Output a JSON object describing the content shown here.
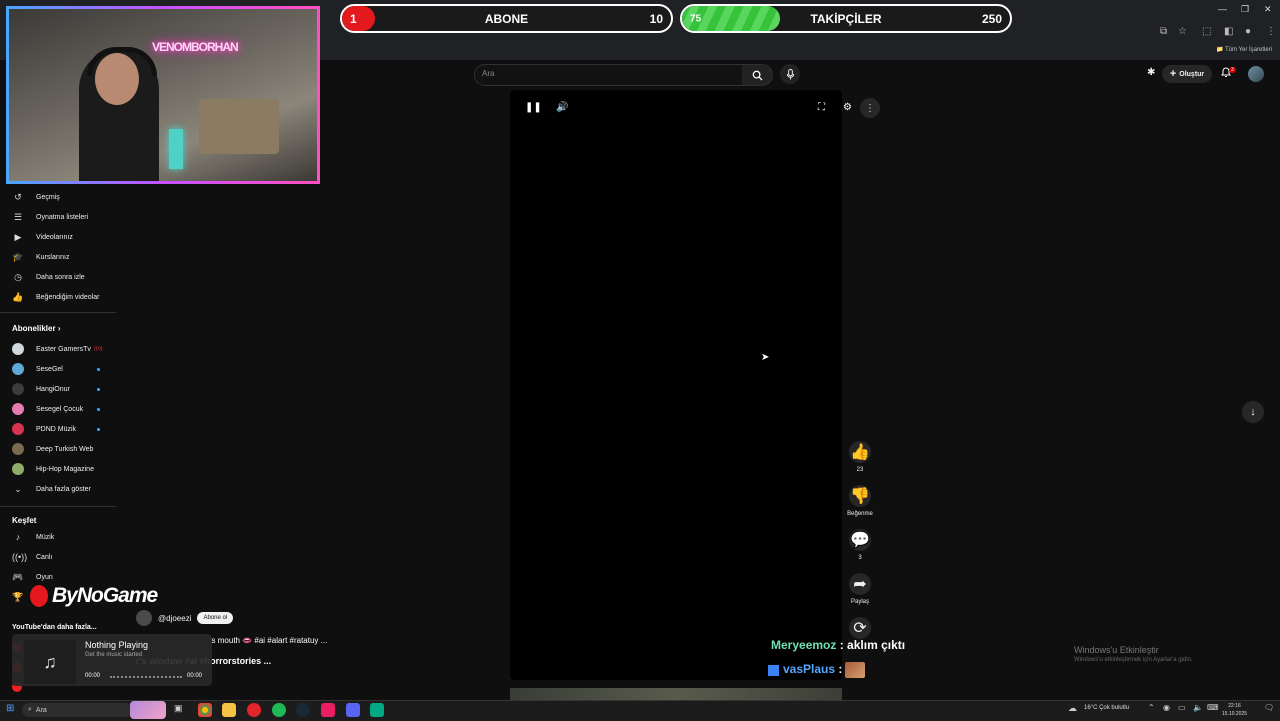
{
  "progress_bars": {
    "abone": {
      "current": "1",
      "label": "ABONE",
      "target": "10",
      "fraction": 0.1
    },
    "takipciler": {
      "current": "75",
      "label": "TAKİPÇİLER",
      "target": "250",
      "fraction": 0.3
    }
  },
  "browser": {
    "bookmarks_all": "Tüm Yer İşaretleri",
    "window_controls": [
      "—",
      "❐",
      "✕"
    ]
  },
  "youtube": {
    "search_placeholder": "Ara",
    "create_label": "Oluştur",
    "notification_count": "3"
  },
  "webcam": {
    "neon_text": "VENOMBORHAN"
  },
  "sidebar": {
    "items": [
      {
        "label": "Geçmiş",
        "icon": "history-icon"
      },
      {
        "label": "Oynatma listeleri",
        "icon": "playlist-icon"
      },
      {
        "label": "Videolarınız",
        "icon": "video-icon"
      },
      {
        "label": "Kurslarınız",
        "icon": "graduation-icon"
      },
      {
        "label": "Daha sonra izle",
        "icon": "clock-icon"
      },
      {
        "label": "Beğendiğim videolar",
        "icon": "thumbs-up-icon"
      }
    ],
    "subscriptions_title": "Abonelikler",
    "subscriptions": [
      {
        "label": "Easter GamersTv",
        "color": "#cfd8dc",
        "live": true
      },
      {
        "label": "SeseGel",
        "color": "#5ea9d6",
        "live": false
      },
      {
        "label": "HangiOnur",
        "color": "#3c3c3c",
        "live": false
      },
      {
        "label": "Sesegel Çocuk",
        "color": "#e57bb0",
        "live": false
      },
      {
        "label": "PDND Müzik",
        "color": "#d9324e",
        "live": false
      },
      {
        "label": "Deep Turkish Web",
        "color": "#7a6a4f",
        "live": false
      },
      {
        "label": "Hip-Hop Magazine",
        "color": "#8fae6b",
        "live": false
      }
    ],
    "show_more": "Daha fazla göster",
    "explore_title": "Keşfet",
    "explore": [
      {
        "label": "Müzik",
        "icon": "music-note-icon"
      },
      {
        "label": "Canlı",
        "icon": "live-icon"
      },
      {
        "label": "Oyun",
        "icon": "gamepad-icon"
      }
    ],
    "more_from_youtube": "YouTube'dan daha fazla..."
  },
  "video": {
    "actions": {
      "likes": "23",
      "dislike_label": "Beğenme",
      "comments": "3",
      "share_label": "Paylaş"
    }
  },
  "short_meta": {
    "channel": "@djoeezi",
    "subscribe": "Abone ol",
    "title_partial": "'s mouth 👄 #ai #alart #ratatuy ...",
    "title2_partial": "r's window #ai #horrorstories ..."
  },
  "sponsor": {
    "name": "ByNoGame"
  },
  "now_playing": {
    "title": "Nothing Playing",
    "subtitle": "Get the music started",
    "time_start": "00:00",
    "time_end": "00:00"
  },
  "chat": [
    {
      "user": "Meryeemoz",
      "message": ": aklım çıktı",
      "color": "#6fe0b4"
    },
    {
      "user": "vasPlaus",
      "message": ":",
      "color": "#57a7ff"
    }
  ],
  "windows_watermark": {
    "title": "Windows'u Etkinleştir",
    "subtitle": "Windows'u etkinleştirmek için Ayarlar'a gidin."
  },
  "taskbar": {
    "search_label": "Ara",
    "weather": "16°C  Çok bulutlu",
    "time": "22:16",
    "date": "15.10.2025"
  }
}
